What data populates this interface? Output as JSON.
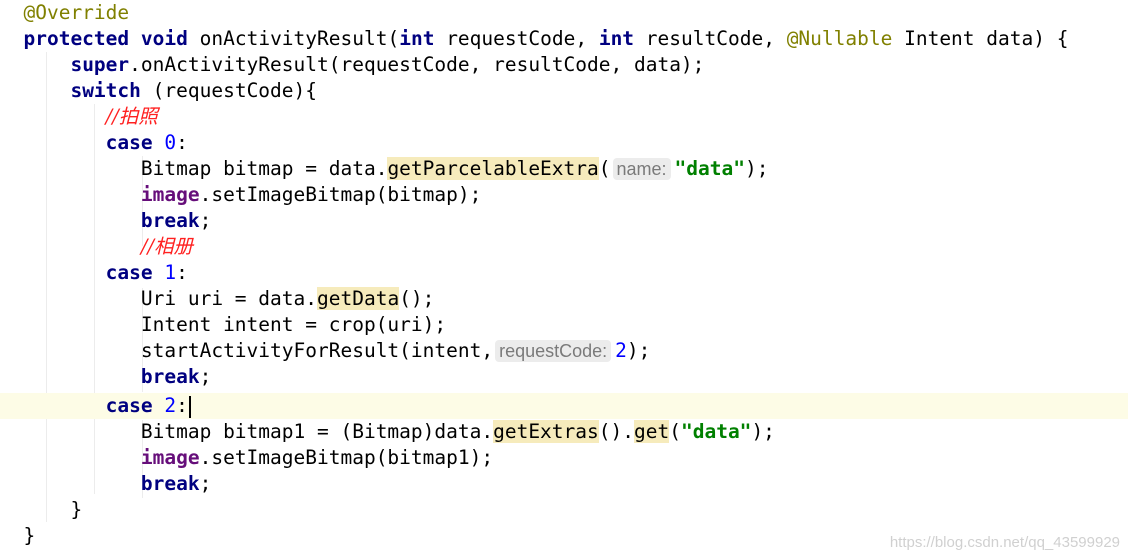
{
  "code": {
    "l1_annotation": "@Override",
    "l2_protected": "protected",
    "l2_void": "void",
    "l2_method": "onActivityResult(",
    "l2_int1": "int",
    "l2_param1": " requestCode, ",
    "l2_int2": "int",
    "l2_param2": " resultCode, ",
    "l2_nullable": "@Nullable",
    "l2_rest": " Intent data) {",
    "l3_super": "super",
    "l3_rest": ".onActivityResult(requestCode, resultCode, data);",
    "l4_switch": "switch",
    "l4_rest": " (requestCode){",
    "l5_comment": "//拍照",
    "l6_case": "case",
    "l6_num": "0",
    "l6_colon": ":",
    "l7_pre": "Bitmap bitmap = data.",
    "l7_method": "getParcelableExtra",
    "l7_open": "(",
    "l7_hint": "name:",
    "l7_str": "\"data\"",
    "l7_close": ");",
    "l8_field": "image",
    "l8_rest": ".setImageBitmap(bitmap);",
    "l9_break": "break",
    "l9_semi": ";",
    "l10_comment": "//相册",
    "l11_case": "case",
    "l11_num": "1",
    "l11_colon": ":",
    "l12_pre": "Uri uri = data.",
    "l12_method": "getData",
    "l12_rest": "();",
    "l13_text": "Intent intent = crop(uri);",
    "l14_pre": "startActivityForResult(intent,",
    "l14_hint": "requestCode:",
    "l14_num": "2",
    "l14_close": ");",
    "l15_break": "break",
    "l15_semi": ";",
    "l16_case": "case",
    "l16_num": "2",
    "l16_colon": ":",
    "l17_pre": "Bitmap bitmap1 = (Bitmap)data.",
    "l17_method1": "getExtras",
    "l17_mid": "().",
    "l17_method2": "get",
    "l17_open": "(",
    "l17_str": "\"data\"",
    "l17_close": ");",
    "l18_field": "image",
    "l18_rest": ".setImageBitmap(bitmap1);",
    "l19_break": "break",
    "l19_semi": ";",
    "l20_brace": "}",
    "l21_brace": "}"
  },
  "watermark": "https://blog.csdn.net/qq_43599929"
}
